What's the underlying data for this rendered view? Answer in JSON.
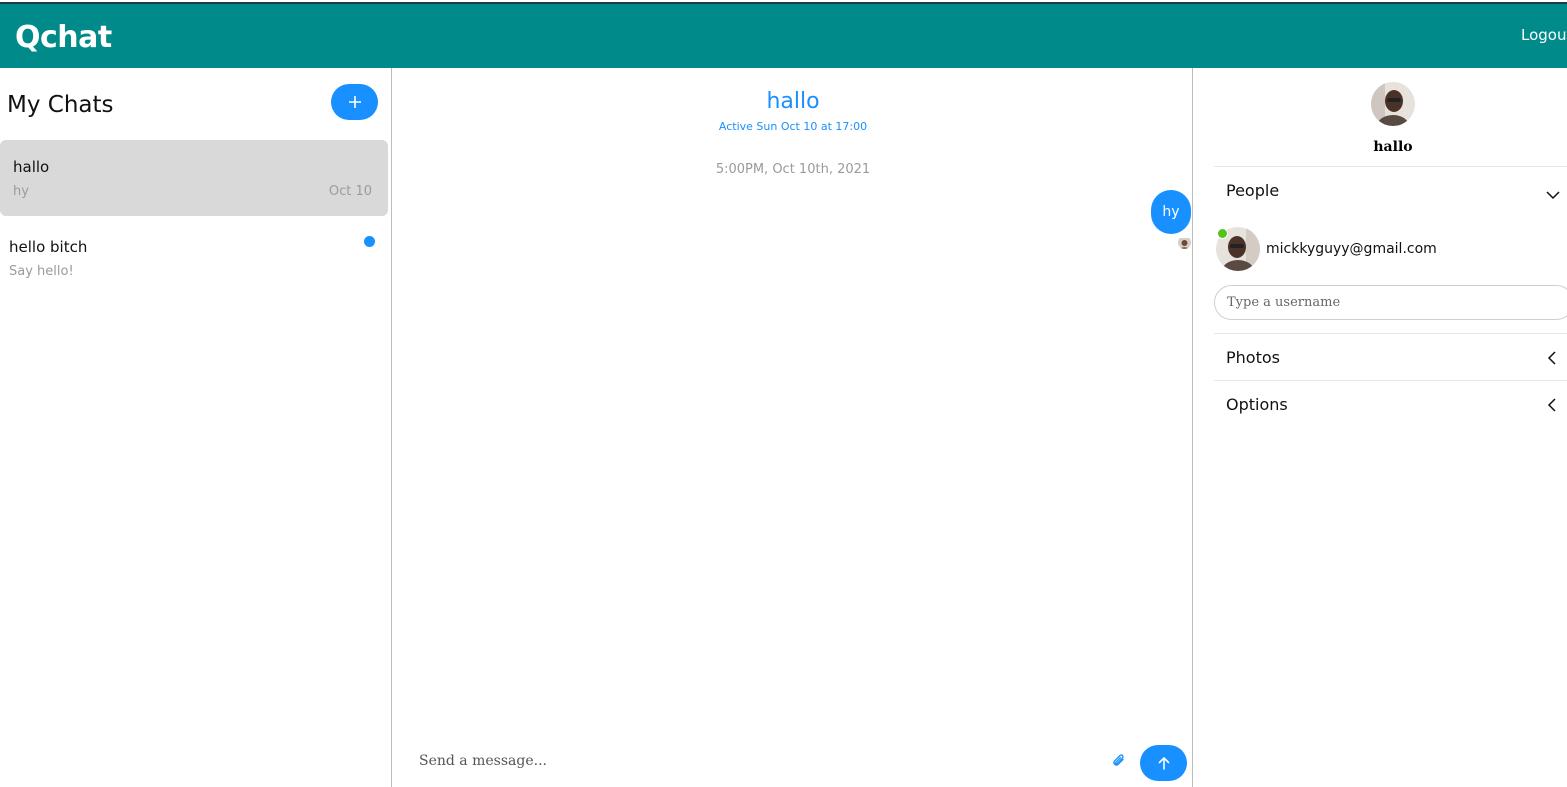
{
  "app": {
    "brand": "Qchat",
    "logout_label": "Logout"
  },
  "colors": {
    "header": "#008b8a",
    "accent": "#1890ff",
    "online": "#52c41a",
    "active_card": "#d9d9d9"
  },
  "sidebar": {
    "title": "My Chats",
    "new_chat_icon": "plus-icon",
    "chats": [
      {
        "name": "hallo",
        "last_message": "hy",
        "date": "Oct 10",
        "active": true,
        "unread": false
      },
      {
        "name": "hello bitch",
        "last_message": "Say hello!",
        "date": "",
        "active": false,
        "unread": true
      }
    ]
  },
  "chat": {
    "title": "hallo",
    "subtitle": "Active Sun Oct 10 at 17:00",
    "timestamp": "5:00PM, Oct 10th, 2021",
    "messages": [
      {
        "text": "hy",
        "own": true
      }
    ],
    "input_placeholder": "Send a message...",
    "attach_icon": "paperclip-icon",
    "send_icon": "arrow-up-icon"
  },
  "details": {
    "name": "hallo",
    "people_label": "People",
    "people": [
      {
        "email": "mickkyguyy@gmail.com",
        "online": true
      }
    ],
    "username_placeholder": "Type a username",
    "photos_label": "Photos",
    "options_label": "Options"
  }
}
